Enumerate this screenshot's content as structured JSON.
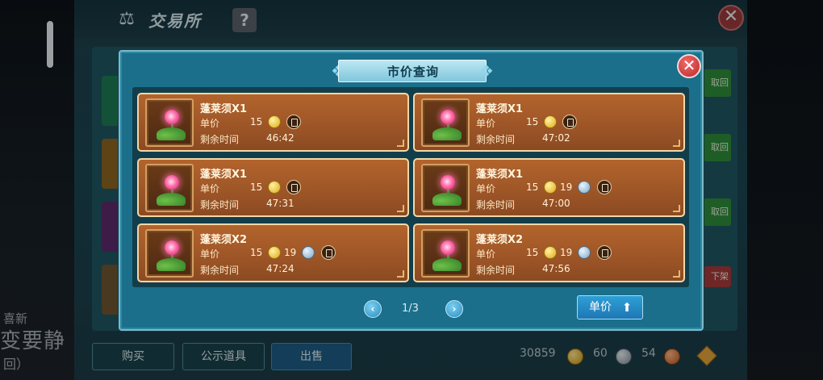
{
  "background": {
    "title": "交易所",
    "help_label": "?",
    "close_label": "✕",
    "left_texts": [
      "喜新",
      "变要静",
      "回）"
    ],
    "side_buttons": [
      "取回",
      "取回",
      "取回",
      "下架"
    ],
    "tabs": [
      "购买",
      "公示道具",
      "出售"
    ],
    "currency": {
      "gold": "30859",
      "silver": "60",
      "copper": "54"
    }
  },
  "modal": {
    "title": "市价查询",
    "close_label": "✕",
    "listings": [
      {
        "name": "蓬莱须X1",
        "price_label": "单价",
        "gold": "15",
        "silver": "",
        "time_label": "剩余时间",
        "time": "46:42"
      },
      {
        "name": "蓬莱须X1",
        "price_label": "单价",
        "gold": "15",
        "silver": "",
        "time_label": "剩余时间",
        "time": "47:02"
      },
      {
        "name": "蓬莱须X1",
        "price_label": "单价",
        "gold": "15",
        "silver": "",
        "time_label": "剩余时间",
        "time": "47:31"
      },
      {
        "name": "蓬莱须X1",
        "price_label": "单价",
        "gold": "15",
        "silver": "19",
        "time_label": "剩余时间",
        "time": "47:00"
      },
      {
        "name": "蓬莱须X2",
        "price_label": "单价",
        "gold": "15",
        "silver": "19",
        "time_label": "剩余时间",
        "time": "47:24"
      },
      {
        "name": "蓬莱须X2",
        "price_label": "单价",
        "gold": "15",
        "silver": "19",
        "time_label": "剩余时间",
        "time": "47:56"
      }
    ],
    "pager": {
      "prev": "‹",
      "next": "›",
      "current": "1/3"
    },
    "sort_button": {
      "label": "单价",
      "arrow": "⬆"
    }
  }
}
